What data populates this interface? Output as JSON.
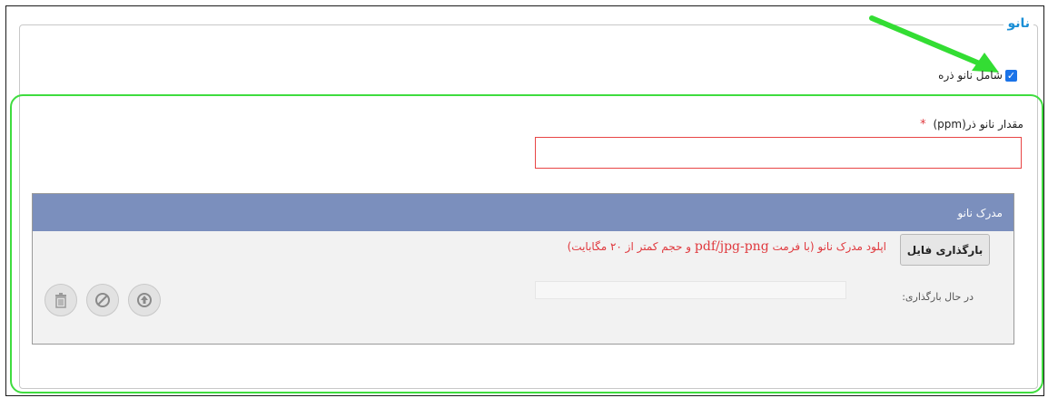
{
  "fieldset": {
    "legend": "نانو"
  },
  "nano_checkbox": {
    "label": "شامل نانو ذره",
    "checked": true,
    "check_glyph": "✓"
  },
  "amount_field": {
    "label": "مقدار نانو ذر(ppm)",
    "required_marker": "*",
    "value": ""
  },
  "document_panel": {
    "title": "مدرک نانو",
    "upload_button_label": "بارگذاری فایل",
    "hint_prefix": "اپلود مدرک نانو (با فرمت",
    "hint_format": "pdf/jpg-png",
    "hint_suffix": "و حجم کمتر از ۲۰ مگابایت)",
    "status_label": "در حال بارگذاری:",
    "actions": {
      "upload_icon": "circle-up-arrow",
      "cancel_icon": "ban",
      "delete_icon": "trash"
    }
  },
  "colors": {
    "legend": "#1a8fd6",
    "panel_header": "#7b8fbd",
    "required": "#e0393e",
    "annotation": "#3fdc3f"
  }
}
